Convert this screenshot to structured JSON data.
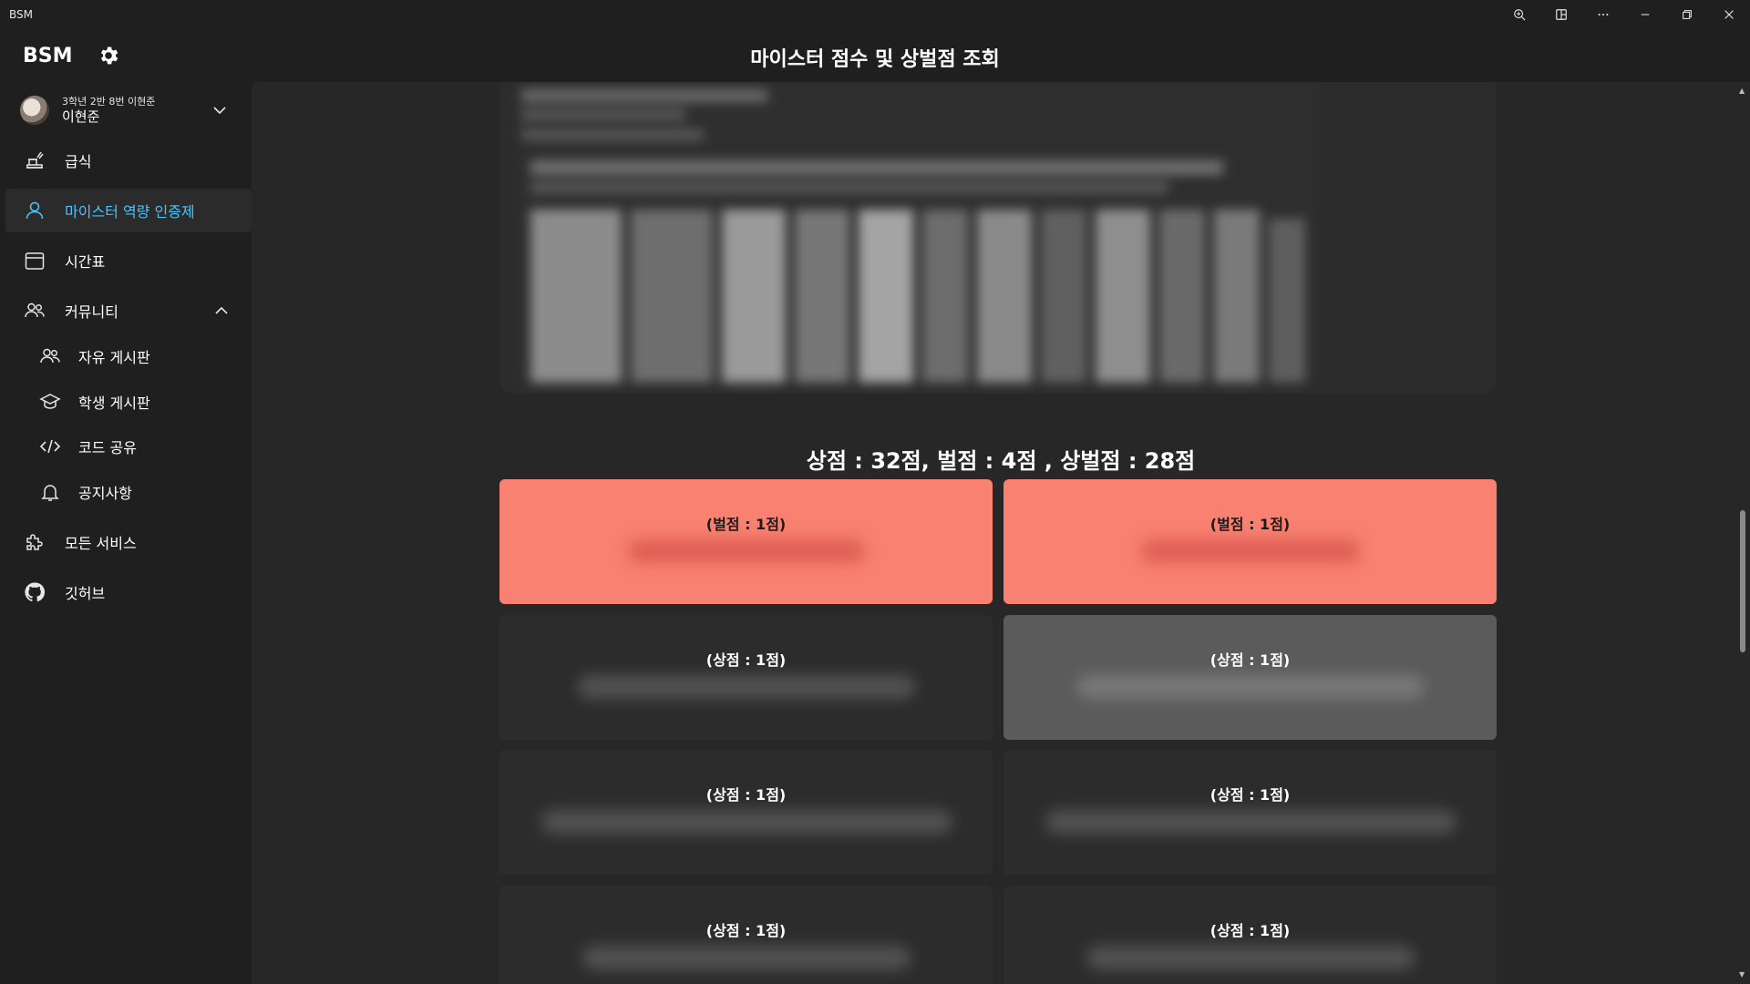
{
  "window": {
    "title": "BSM",
    "controls": [
      "zoom-icon",
      "snap-icon",
      "more-icon",
      "minimize-icon",
      "restore-icon",
      "close-icon"
    ]
  },
  "header": {
    "logo": "BSM",
    "page_title": "마이스터 점수 및 상벌점 조회"
  },
  "profile": {
    "subtitle": "3학년 2반 8번 이현준",
    "name": "이현준"
  },
  "sidebar": {
    "items": [
      {
        "label": "급식",
        "icon": "meal-icon"
      },
      {
        "label": "마이스터 역량 인증제",
        "icon": "person-icon",
        "active": true
      },
      {
        "label": "시간표",
        "icon": "calendar-icon"
      },
      {
        "label": "커뮤니티",
        "icon": "people-icon",
        "expanded": true
      },
      {
        "label": "자유 게시판",
        "icon": "people-icon"
      },
      {
        "label": "학생 게시판",
        "icon": "graduation-cap-icon"
      },
      {
        "label": "코드 공유",
        "icon": "code-icon"
      },
      {
        "label": "공지사항",
        "icon": "bell-icon"
      },
      {
        "label": "모든 서비스",
        "icon": "puzzle-icon"
      },
      {
        "label": "깃허브",
        "icon": "github-icon"
      }
    ]
  },
  "main": {
    "summary": "상점 : 32점, 벌점 : 4점 , 상벌점 : 28점",
    "cards": [
      {
        "title": "(벌점 : 1점)",
        "type": "penalty"
      },
      {
        "title": "(벌점 : 1점)",
        "type": "penalty"
      },
      {
        "title": "(상점 : 1점)",
        "type": "reward"
      },
      {
        "title": "(상점 : 1점)",
        "type": "reward",
        "hovered": true
      },
      {
        "title": "(상점 : 1점)",
        "type": "reward"
      },
      {
        "title": "(상점 : 1점)",
        "type": "reward"
      },
      {
        "title": "(상점 : 1점)",
        "type": "reward"
      },
      {
        "title": "(상점 : 1점)",
        "type": "reward"
      }
    ]
  },
  "colors": {
    "accent": "#4cc2ff",
    "penalty_card": "#f98171",
    "card": "#2c2c2c",
    "background": "#202020"
  }
}
